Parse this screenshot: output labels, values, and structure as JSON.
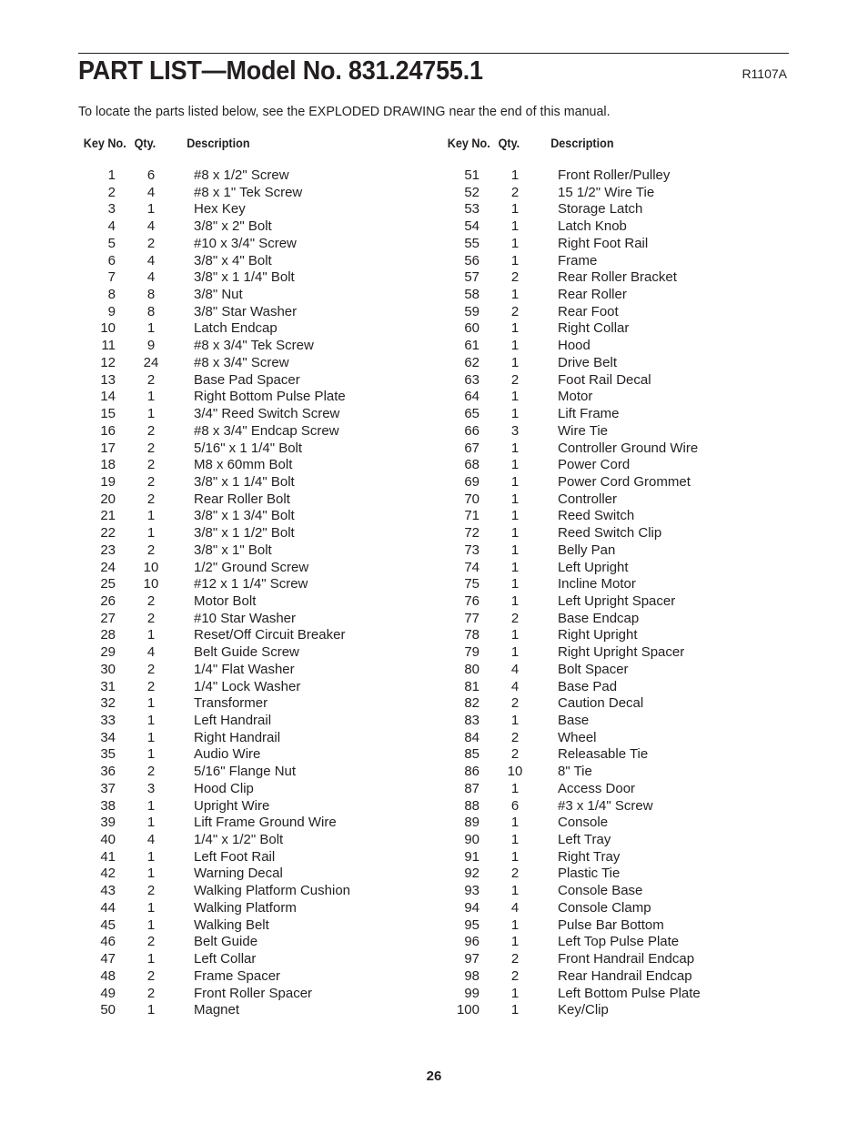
{
  "page": {
    "title": "PART LIST—Model No. 831.24755.1",
    "ref_code": "R1107A",
    "intro": "To locate the parts listed below, see the EXPLODED DRAWING near the end of this manual.",
    "page_number": "26"
  },
  "columns": {
    "key_header": "Key No.",
    "qty_header": "Qty.",
    "desc_header": "Description"
  },
  "left_parts": [
    {
      "key": "1",
      "qty": "6",
      "desc": "#8 x 1/2\" Screw"
    },
    {
      "key": "2",
      "qty": "4",
      "desc": "#8 x 1\" Tek Screw"
    },
    {
      "key": "3",
      "qty": "1",
      "desc": "Hex Key"
    },
    {
      "key": "4",
      "qty": "4",
      "desc": "3/8\" x 2\" Bolt"
    },
    {
      "key": "5",
      "qty": "2",
      "desc": "#10 x 3/4\" Screw"
    },
    {
      "key": "6",
      "qty": "4",
      "desc": "3/8\" x 4\" Bolt"
    },
    {
      "key": "7",
      "qty": "4",
      "desc": "3/8\" x 1 1/4\" Bolt"
    },
    {
      "key": "8",
      "qty": "8",
      "desc": "3/8\" Nut"
    },
    {
      "key": "9",
      "qty": "8",
      "desc": "3/8\" Star Washer"
    },
    {
      "key": "10",
      "qty": "1",
      "desc": "Latch Endcap"
    },
    {
      "key": "11",
      "qty": "9",
      "desc": "#8 x 3/4\" Tek Screw"
    },
    {
      "key": "12",
      "qty": "24",
      "desc": "#8 x 3/4\" Screw"
    },
    {
      "key": "13",
      "qty": "2",
      "desc": "Base Pad Spacer"
    },
    {
      "key": "14",
      "qty": "1",
      "desc": "Right Bottom Pulse Plate"
    },
    {
      "key": "15",
      "qty": "1",
      "desc": "3/4\" Reed Switch Screw"
    },
    {
      "key": "16",
      "qty": "2",
      "desc": "#8 x 3/4\" Endcap Screw"
    },
    {
      "key": "17",
      "qty": "2",
      "desc": "5/16\" x 1 1/4\" Bolt"
    },
    {
      "key": "18",
      "qty": "2",
      "desc": "M8 x 60mm Bolt"
    },
    {
      "key": "19",
      "qty": "2",
      "desc": "3/8\" x 1 1/4\" Bolt"
    },
    {
      "key": "20",
      "qty": "2",
      "desc": "Rear Roller Bolt"
    },
    {
      "key": "21",
      "qty": "1",
      "desc": "3/8\" x 1 3/4\" Bolt"
    },
    {
      "key": "22",
      "qty": "1",
      "desc": "3/8\" x 1 1/2\" Bolt"
    },
    {
      "key": "23",
      "qty": "2",
      "desc": "3/8\" x 1\" Bolt"
    },
    {
      "key": "24",
      "qty": "10",
      "desc": "1/2\" Ground Screw"
    },
    {
      "key": "25",
      "qty": "10",
      "desc": "#12 x 1 1/4\" Screw"
    },
    {
      "key": "26",
      "qty": "2",
      "desc": "Motor Bolt"
    },
    {
      "key": "27",
      "qty": "2",
      "desc": "#10 Star Washer"
    },
    {
      "key": "28",
      "qty": "1",
      "desc": "Reset/Off Circuit Breaker"
    },
    {
      "key": "29",
      "qty": "4",
      "desc": "Belt Guide Screw"
    },
    {
      "key": "30",
      "qty": "2",
      "desc": "1/4\" Flat Washer"
    },
    {
      "key": "31",
      "qty": "2",
      "desc": "1/4\" Lock Washer"
    },
    {
      "key": "32",
      "qty": "1",
      "desc": "Transformer"
    },
    {
      "key": "33",
      "qty": "1",
      "desc": "Left Handrail"
    },
    {
      "key": "34",
      "qty": "1",
      "desc": "Right Handrail"
    },
    {
      "key": "35",
      "qty": "1",
      "desc": "Audio Wire"
    },
    {
      "key": "36",
      "qty": "2",
      "desc": "5/16\" Flange Nut"
    },
    {
      "key": "37",
      "qty": "3",
      "desc": "Hood Clip"
    },
    {
      "key": "38",
      "qty": "1",
      "desc": "Upright Wire"
    },
    {
      "key": "39",
      "qty": "1",
      "desc": "Lift Frame Ground Wire"
    },
    {
      "key": "40",
      "qty": "4",
      "desc": "1/4\" x 1/2\" Bolt"
    },
    {
      "key": "41",
      "qty": "1",
      "desc": "Left Foot Rail"
    },
    {
      "key": "42",
      "qty": "1",
      "desc": "Warning Decal"
    },
    {
      "key": "43",
      "qty": "2",
      "desc": "Walking Platform Cushion"
    },
    {
      "key": "44",
      "qty": "1",
      "desc": "Walking Platform"
    },
    {
      "key": "45",
      "qty": "1",
      "desc": "Walking Belt"
    },
    {
      "key": "46",
      "qty": "2",
      "desc": "Belt Guide"
    },
    {
      "key": "47",
      "qty": "1",
      "desc": "Left Collar"
    },
    {
      "key": "48",
      "qty": "2",
      "desc": "Frame Spacer"
    },
    {
      "key": "49",
      "qty": "2",
      "desc": "Front Roller Spacer"
    },
    {
      "key": "50",
      "qty": "1",
      "desc": "Magnet"
    }
  ],
  "right_parts": [
    {
      "key": "51",
      "qty": "1",
      "desc": "Front Roller/Pulley"
    },
    {
      "key": "52",
      "qty": "2",
      "desc": "15 1/2\" Wire Tie"
    },
    {
      "key": "53",
      "qty": "1",
      "desc": "Storage Latch"
    },
    {
      "key": "54",
      "qty": "1",
      "desc": "Latch Knob"
    },
    {
      "key": "55",
      "qty": "1",
      "desc": "Right Foot Rail"
    },
    {
      "key": "56",
      "qty": "1",
      "desc": "Frame"
    },
    {
      "key": "57",
      "qty": "2",
      "desc": "Rear Roller Bracket"
    },
    {
      "key": "58",
      "qty": "1",
      "desc": "Rear Roller"
    },
    {
      "key": "59",
      "qty": "2",
      "desc": "Rear Foot"
    },
    {
      "key": "60",
      "qty": "1",
      "desc": "Right Collar"
    },
    {
      "key": "61",
      "qty": "1",
      "desc": "Hood"
    },
    {
      "key": "62",
      "qty": "1",
      "desc": "Drive Belt"
    },
    {
      "key": "63",
      "qty": "2",
      "desc": "Foot Rail Decal"
    },
    {
      "key": "64",
      "qty": "1",
      "desc": "Motor"
    },
    {
      "key": "65",
      "qty": "1",
      "desc": "Lift Frame"
    },
    {
      "key": "66",
      "qty": "3",
      "desc": "Wire Tie"
    },
    {
      "key": "67",
      "qty": "1",
      "desc": "Controller Ground Wire"
    },
    {
      "key": "68",
      "qty": "1",
      "desc": "Power Cord"
    },
    {
      "key": "69",
      "qty": "1",
      "desc": "Power Cord Grommet"
    },
    {
      "key": "70",
      "qty": "1",
      "desc": "Controller"
    },
    {
      "key": "71",
      "qty": "1",
      "desc": "Reed Switch"
    },
    {
      "key": "72",
      "qty": "1",
      "desc": "Reed Switch Clip"
    },
    {
      "key": "73",
      "qty": "1",
      "desc": "Belly Pan"
    },
    {
      "key": "74",
      "qty": "1",
      "desc": "Left Upright"
    },
    {
      "key": "75",
      "qty": "1",
      "desc": "Incline Motor"
    },
    {
      "key": "76",
      "qty": "1",
      "desc": "Left Upright Spacer"
    },
    {
      "key": "77",
      "qty": "2",
      "desc": "Base Endcap"
    },
    {
      "key": "78",
      "qty": "1",
      "desc": "Right Upright"
    },
    {
      "key": "79",
      "qty": "1",
      "desc": "Right Upright Spacer"
    },
    {
      "key": "80",
      "qty": "4",
      "desc": "Bolt Spacer"
    },
    {
      "key": "81",
      "qty": "4",
      "desc": "Base Pad"
    },
    {
      "key": "82",
      "qty": "2",
      "desc": "Caution Decal"
    },
    {
      "key": "83",
      "qty": "1",
      "desc": "Base"
    },
    {
      "key": "84",
      "qty": "2",
      "desc": "Wheel"
    },
    {
      "key": "85",
      "qty": "2",
      "desc": "Releasable Tie"
    },
    {
      "key": "86",
      "qty": "10",
      "desc": "8\" Tie"
    },
    {
      "key": "87",
      "qty": "1",
      "desc": "Access Door"
    },
    {
      "key": "88",
      "qty": "6",
      "desc": "#3 x 1/4\" Screw"
    },
    {
      "key": "89",
      "qty": "1",
      "desc": "Console"
    },
    {
      "key": "90",
      "qty": "1",
      "desc": "Left Tray"
    },
    {
      "key": "91",
      "qty": "1",
      "desc": "Right Tray"
    },
    {
      "key": "92",
      "qty": "2",
      "desc": "Plastic Tie"
    },
    {
      "key": "93",
      "qty": "1",
      "desc": "Console Base"
    },
    {
      "key": "94",
      "qty": "4",
      "desc": "Console Clamp"
    },
    {
      "key": "95",
      "qty": "1",
      "desc": "Pulse Bar Bottom"
    },
    {
      "key": "96",
      "qty": "1",
      "desc": "Left Top Pulse Plate"
    },
    {
      "key": "97",
      "qty": "2",
      "desc": "Front Handrail Endcap"
    },
    {
      "key": "98",
      "qty": "2",
      "desc": "Rear Handrail Endcap"
    },
    {
      "key": "99",
      "qty": "1",
      "desc": "Left Bottom Pulse Plate"
    },
    {
      "key": "100",
      "qty": "1",
      "desc": "Key/Clip"
    }
  ]
}
